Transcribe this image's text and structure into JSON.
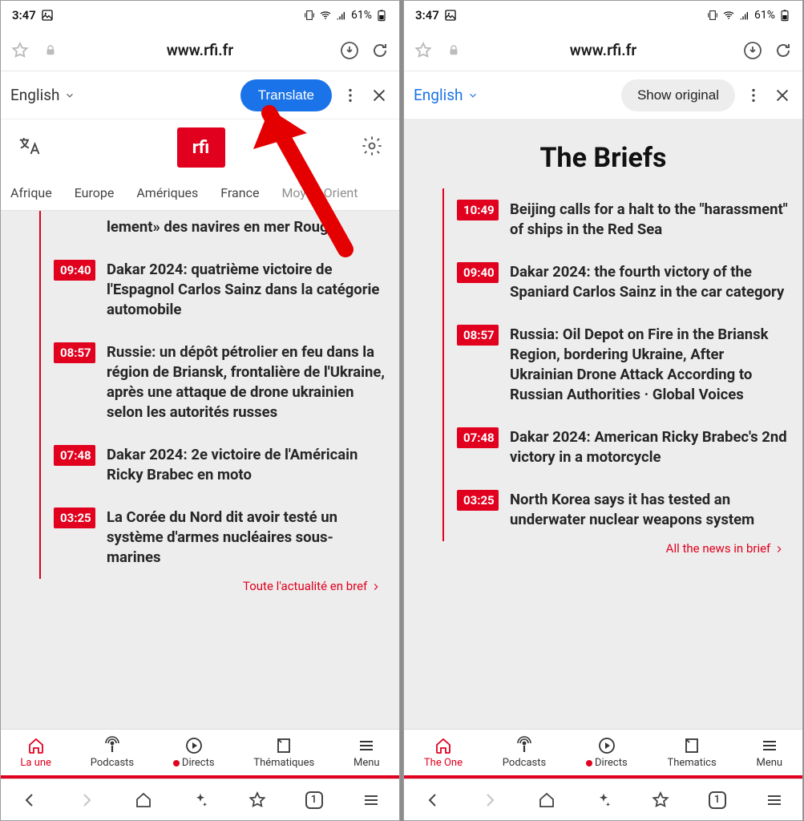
{
  "status": {
    "time": "3:47",
    "battery": "61%"
  },
  "url": "www.rfi.fr",
  "left": {
    "lang_label": "English",
    "translate_btn": "Translate",
    "logo": "rfi",
    "tabs": [
      "Afrique",
      "Europe",
      "Amériques",
      "France",
      "Moyen-Orient"
    ],
    "briefs": [
      {
        "time": "",
        "text": "lement» des navires en mer Rouge"
      },
      {
        "time": "09:40",
        "text": "Dakar 2024: quatrième victoire de l'Espagnol Carlos Sainz dans la catégorie automobile"
      },
      {
        "time": "08:57",
        "text": "Russie: un dépôt pétrolier en feu dans la région de Briansk, fronta­lière de l'Ukraine, après une at­taque de drone ukrainien selon les autorités russes"
      },
      {
        "time": "07:48",
        "text": "Dakar 2024: 2e victoire de l'Amé­ricain Ricky Brabec en moto"
      },
      {
        "time": "03:25",
        "text": "La Corée du Nord dit avoir testé un système d'armes nucléaires sous-marines"
      }
    ],
    "more": "Toute l'actualité en bref",
    "nav": [
      "La une",
      "Podcasts",
      "Directs",
      "Thématiques",
      "Menu"
    ]
  },
  "right": {
    "lang_label": "English",
    "show_original_btn": "Show original",
    "section_title": "The Briefs",
    "briefs": [
      {
        "time": "10:49",
        "text": "Beijing calls for a halt to the \"ha­rassment\" of ships in the Red Sea"
      },
      {
        "time": "09:40",
        "text": "Dakar 2024: the fourth victory of the Spaniard Carlos Sainz in the car category"
      },
      {
        "time": "08:57",
        "text": "Russia: Oil Depot on Fire in the Briansk Region, bordering Ukraine, After Ukrainian Drone Attack According to Russian Au­thorities · Global Voices"
      },
      {
        "time": "07:48",
        "text": "Dakar 2024: American Ricky Bra­bec's 2nd victory in a motorcycle"
      },
      {
        "time": "03:25",
        "text": "North Korea says it has tested an underwater nuclear weapons system"
      }
    ],
    "more": "All the news in brief",
    "nav": [
      "The One",
      "Podcasts",
      "Directs",
      "Thematics",
      "Menu"
    ]
  },
  "chrome_tabs": "1"
}
